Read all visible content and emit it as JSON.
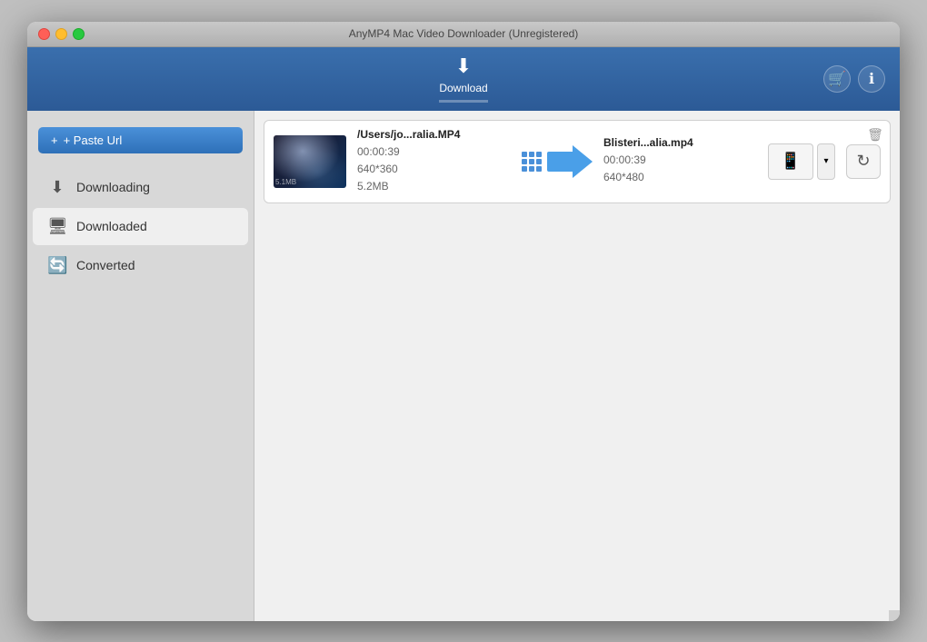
{
  "window": {
    "title": "AnyMP4 Mac Video Downloader (Unregistered)"
  },
  "toolbar": {
    "download_label": "Download",
    "download_icon": "⬇",
    "cart_icon": "🛒",
    "info_icon": "ℹ"
  },
  "sidebar": {
    "paste_url_label": "+ Paste Url",
    "items": [
      {
        "id": "downloading",
        "label": "Downloading",
        "icon": "⬇"
      },
      {
        "id": "downloaded",
        "label": "Downloaded",
        "icon": "🖥"
      },
      {
        "id": "converted",
        "label": "Converted",
        "icon": "🔄"
      }
    ]
  },
  "file_row": {
    "source_filename": "/Users/jo...ralia.MP4",
    "source_duration": "00:00:39",
    "source_resolution": "640*360",
    "source_size": "5.2MB",
    "output_filename": "Blisteri...alia.mp4",
    "output_duration": "00:00:39",
    "output_resolution": "640*480",
    "thumbnail_label": "5.1MB",
    "delete_icon": "🗑",
    "dropdown_icon": "▾",
    "refresh_icon": "↻"
  }
}
